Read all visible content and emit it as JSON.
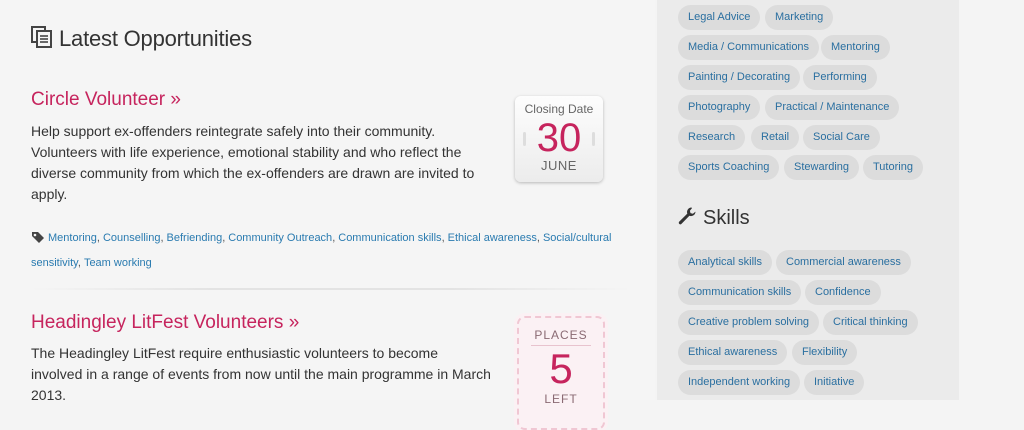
{
  "main": {
    "heading": "Latest Opportunities",
    "opportunities": [
      {
        "title": "Circle Volunteer »",
        "description": "Help support ex-offenders reintegrate safely into their community. Volunteers with life experience, emotional stability and who reflect the diverse community from which the ex-offenders are drawn are invited to apply.",
        "badge": {
          "label": "Closing Date",
          "day": "30",
          "month": "JUNE"
        },
        "tags": [
          "Mentoring",
          "Counselling",
          "Befriending",
          "Community Outreach",
          "Communication skills",
          "Ethical awareness",
          "Social/cultural sensitivity",
          "Team working"
        ]
      },
      {
        "title": "Headingley LitFest Volunteers »",
        "description": "The Headingley LitFest require enthusiastic volunteers to become involved in a range of events from now until the main programme in March 2013.",
        "badge": {
          "label": "PLACES",
          "count": "5",
          "suffix": "LEFT"
        }
      }
    ]
  },
  "sidebar": {
    "categories": [
      "Legal Advice",
      "Marketing",
      "Media / Communications",
      "Mentoring",
      "Painting / Decorating",
      "Performing",
      "Photography",
      "Practical / Maintenance",
      "Research",
      "Retail",
      "Social Care",
      "Sports Coaching",
      "Stewarding",
      "Tutoring"
    ],
    "skills_heading": "Skills",
    "skills": [
      "Analytical skills",
      "Commercial awareness",
      "Communication skills",
      "Confidence",
      "Creative problem solving",
      "Critical thinking",
      "Ethical awareness",
      "Flexibility",
      "Independent working",
      "Initiative"
    ]
  },
  "colors": {
    "accent": "#c6245d",
    "link": "#2a7bb0",
    "pill_bg": "#dcdcdc"
  },
  "icons": {
    "heading": "documents-icon",
    "tags": "tag-icon",
    "skills": "wrench-icon"
  }
}
